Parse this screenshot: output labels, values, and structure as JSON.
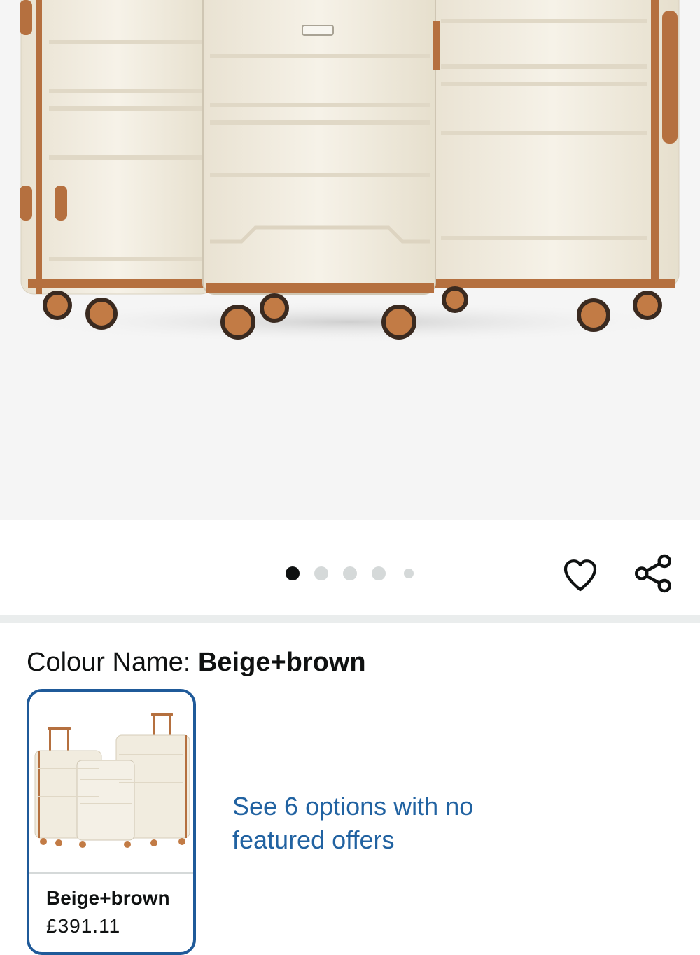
{
  "product": {
    "image_alt": "Three-piece beige and brown hard-shell luggage set",
    "gallery": {
      "total_images": 5,
      "active_index": 0
    }
  },
  "actions": {
    "wishlist_icon": "heart-outline-icon",
    "share_icon": "share-icon"
  },
  "variation": {
    "label": "Colour Name: ",
    "selected_value": "Beige+brown"
  },
  "swatch": {
    "name": "Beige+brown",
    "price": "£391.11"
  },
  "other_options": {
    "link_text": "See 6 options with no featured offers"
  },
  "colors": {
    "accent_link": "#2162a1",
    "selected_border": "#1f5a99",
    "luggage_body": "#f1ecdf",
    "luggage_trim": "#b5703f"
  }
}
